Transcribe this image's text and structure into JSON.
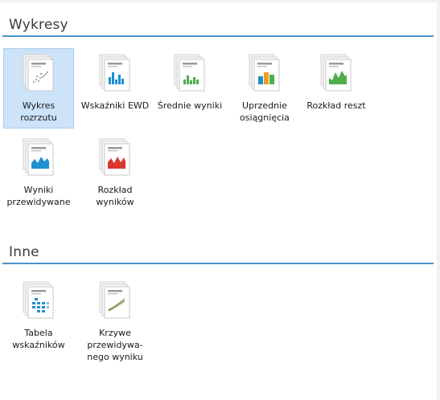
{
  "sections": [
    {
      "title": "Wykresy",
      "items": [
        {
          "label": "Wykres rozrzutu",
          "icon": "scatter-chart-icon",
          "selected": true
        },
        {
          "label": "Wskaźniki EWD",
          "icon": "bar-chart-blue-icon",
          "selected": false
        },
        {
          "label": "Średnie wyniki",
          "icon": "bar-chart-green-icon",
          "selected": false
        },
        {
          "label": "Uprzednie osiągnięcia",
          "icon": "bar-chart-multicolor-icon",
          "selected": false
        },
        {
          "label": "Rozkład reszt",
          "icon": "area-chart-green-icon",
          "selected": false
        },
        {
          "label": "Wyniki przewidywane",
          "icon": "area-chart-blue-icon",
          "selected": false
        },
        {
          "label": "Rozkład wyników",
          "icon": "area-chart-red-icon",
          "selected": false
        }
      ]
    },
    {
      "title": "Inne",
      "items": [
        {
          "label": "Tabela wskaźników",
          "icon": "table-grid-icon",
          "selected": false
        },
        {
          "label": "Krzywe przewidywa-nego wyniku",
          "icon": "curve-chart-icon",
          "selected": false
        }
      ]
    }
  ],
  "colors": {
    "accent": "#4a93c9",
    "selection_bg": "#cce3f8",
    "selection_border": "#a9cdee",
    "blue": "#1e8fd0",
    "green": "#4fae4a",
    "orange": "#f29c1f",
    "red": "#d9372e"
  }
}
